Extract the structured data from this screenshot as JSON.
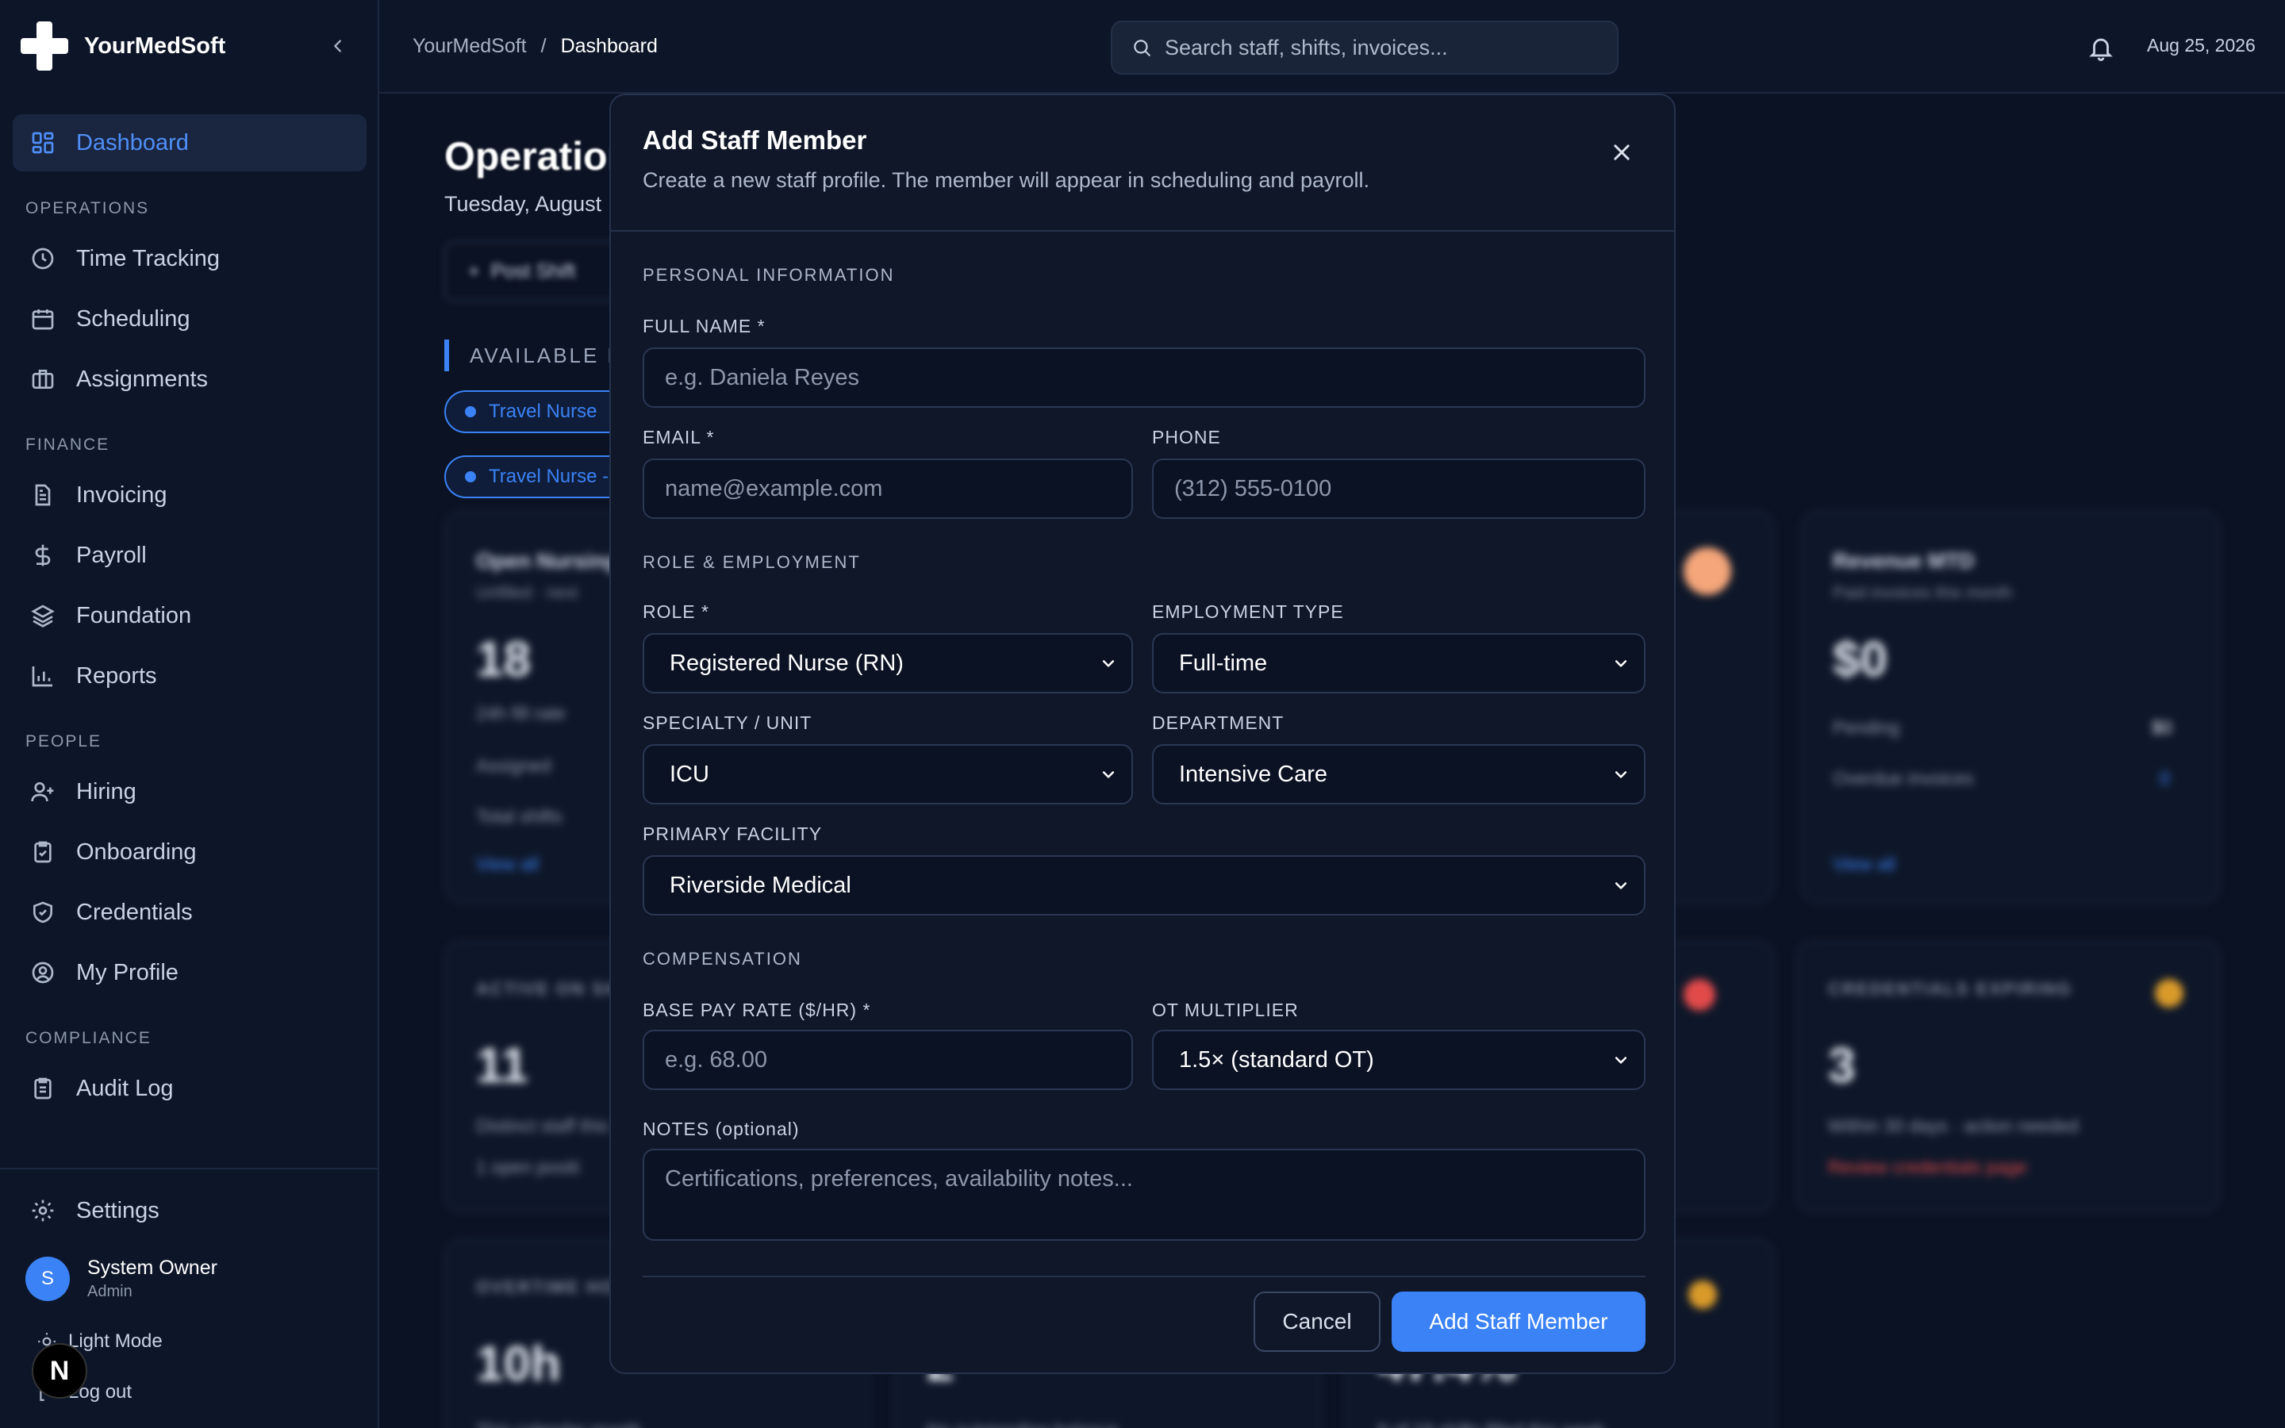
{
  "app": {
    "name": "YourMedSoft"
  },
  "sidebar": {
    "dashboard": "Dashboard",
    "sections": {
      "operations": "OPERATIONS",
      "finance": "FINANCE",
      "people": "PEOPLE",
      "compliance": "COMPLIANCE"
    },
    "items": {
      "time_tracking": "Time Tracking",
      "scheduling": "Scheduling",
      "assignments": "Assignments",
      "invoicing": "Invoicing",
      "payroll": "Payroll",
      "foundation": "Foundation",
      "reports": "Reports",
      "hiring": "Hiring",
      "onboarding": "Onboarding",
      "credentials": "Credentials",
      "my_profile": "My Profile",
      "audit_log": "Audit Log",
      "settings": "Settings"
    },
    "user": {
      "initial": "S",
      "name": "System Owner",
      "role": "Admin"
    },
    "light_mode": "Light Mode",
    "logout": "Log out",
    "badge": "N"
  },
  "header": {
    "breadcrumb_root": "YourMedSoft",
    "breadcrumb_sep": "/",
    "breadcrumb_current": "Dashboard",
    "search_placeholder": "Search staff, shifts, invoices...",
    "date": "Aug 25, 2026"
  },
  "background": {
    "title": "Operations",
    "date": "Tuesday, August",
    "post_shift": "Post Shift",
    "available_label": "AVAILABLE P",
    "chip1": "Travel Nurse",
    "chip2": "Travel Nurse -",
    "cards": {
      "open_nursing": {
        "title": "Open Nursing",
        "sub": "Unfilled · next",
        "value": "18",
        "l1": "24h fill rate",
        "l2": "Assigned",
        "l3": "Total shifts",
        "link": "View all"
      },
      "revenue": {
        "title": "Revenue MTD",
        "sub": "Paid invoices this month",
        "value": "$0",
        "l1": "Pending",
        "v1": "$0",
        "l2": "Overdue invoices",
        "v2": "0",
        "link": "View all"
      },
      "active_staff": {
        "title": "ACTIVE ON SH",
        "value": "11",
        "l1": "Distinct staff this",
        "l2": "1 open positi"
      },
      "credentials": {
        "title": "CREDENTIALS EXPIRING",
        "value": "3",
        "l1": "Within 30 days · action needed",
        "l2": "Review credentials page"
      },
      "overtime": {
        "title": "OVERTIME HO",
        "value": "10h",
        "l1": "This calendar month"
      },
      "balance": {
        "value": "2",
        "l1": "No outstanding balance"
      },
      "fill": {
        "value": "47.4%",
        "l1": "9 of 19 shifts filled this week"
      }
    }
  },
  "modal": {
    "title": "Add Staff Member",
    "subtitle": "Create a new staff profile. The member will appear in scheduling and payroll.",
    "sections": {
      "personal": "PERSONAL INFORMATION",
      "role": "ROLE & EMPLOYMENT",
      "compensation": "COMPENSATION"
    },
    "labels": {
      "full_name": "FULL NAME *",
      "email": "EMAIL *",
      "phone": "PHONE",
      "role": "ROLE *",
      "employment_type": "EMPLOYMENT TYPE",
      "specialty": "SPECIALTY / UNIT",
      "department": "DEPARTMENT",
      "facility": "PRIMARY FACILITY",
      "base_pay": "BASE PAY RATE ($/HR) *",
      "ot": "OT MULTIPLIER",
      "notes": "NOTES (optional)"
    },
    "placeholders": {
      "full_name": "e.g. Daniela Reyes",
      "email": "name@example.com",
      "phone": "(312) 555-0100",
      "base_pay": "e.g. 68.00",
      "notes": "Certifications, preferences, availability notes..."
    },
    "values": {
      "role": "Registered Nurse (RN)",
      "employment_type": "Full-time",
      "specialty": "ICU",
      "department": "Intensive Care",
      "facility": "Riverside Medical",
      "ot": "1.5× (standard OT)"
    },
    "buttons": {
      "cancel": "Cancel",
      "add": "Add Staff Member"
    }
  }
}
